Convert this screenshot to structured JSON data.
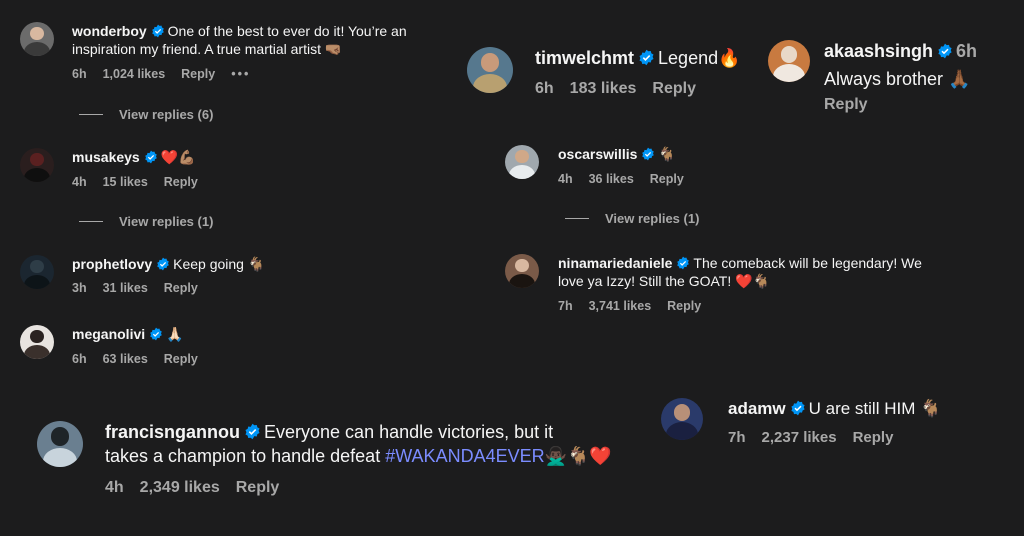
{
  "colors": {
    "background": "#1c1c1d",
    "text": "#f5f5f5",
    "meta": "#a8a8a8",
    "verified": "#0095f6",
    "hashtag": "#7b8cff"
  },
  "comments": [
    {
      "id": "wonderboy",
      "username": "wonderboy",
      "text_line1": "One of the best to ever do it! You’re an",
      "text_line2": "inspiration my friend. A true martial artist 🤜🏽",
      "time": "6h",
      "likes": "1,024 likes",
      "reply": "Reply",
      "more": "•••",
      "view_replies": "View replies (6)"
    },
    {
      "id": "musakeys",
      "username": "musakeys",
      "text": "❤️💪🏽",
      "time": "4h",
      "likes": "15 likes",
      "reply": "Reply",
      "view_replies": "View replies (1)"
    },
    {
      "id": "prophetlovy",
      "username": "prophetlovy",
      "text": "Keep going 🐐",
      "time": "3h",
      "likes": "31 likes",
      "reply": "Reply"
    },
    {
      "id": "meganolivi",
      "username": "meganolivi",
      "text": "🙏🏻",
      "time": "6h",
      "likes": "63 likes",
      "reply": "Reply"
    },
    {
      "id": "francisngannou",
      "username": "francisngannou",
      "text_line1": "Everyone can handle victories, but it",
      "text_line2": "takes a champion to handle defeat",
      "hashtag": "#WAKANDA4EVER",
      "emoji_tail": "🙅🏿‍♂️🐐❤️",
      "time": "4h",
      "likes": "2,349 likes",
      "reply": "Reply"
    },
    {
      "id": "timwelchmt",
      "username": "timwelchmt",
      "text": "Legend🔥",
      "time": "6h",
      "likes": "183 likes",
      "reply": "Reply"
    },
    {
      "id": "akaashsingh",
      "username": "akaashsingh",
      "time": "6h",
      "text": "Always brother 🙏🏾",
      "reply": "Reply"
    },
    {
      "id": "oscarswillis",
      "username": "oscarswillis",
      "text": "🐐",
      "time": "4h",
      "likes": "36 likes",
      "reply": "Reply",
      "view_replies": "View replies (1)"
    },
    {
      "id": "ninamariedaniele",
      "username": "ninamariedaniele",
      "text_line1": "The comeback will be legendary! We",
      "text_line2": "love ya Izzy! Still the GOAT! ❤️🐐",
      "time": "7h",
      "likes": "3,741 likes",
      "reply": "Reply"
    },
    {
      "id": "adamw",
      "username": "adamw",
      "text": "U are still HIM 🐐",
      "time": "7h",
      "likes": "2,237 likes",
      "reply": "Reply"
    }
  ]
}
